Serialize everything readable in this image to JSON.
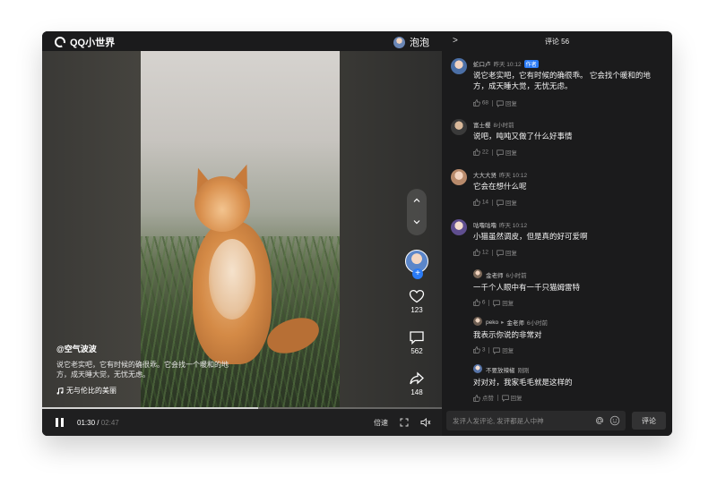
{
  "header": {
    "app_name": "QQ小世界",
    "user_name": "泡泡"
  },
  "video": {
    "author": "@空气波波",
    "description": "说它老实吧，它有时候的确很乖。它会找一个暖和的地方，成天睡大觉，无忧无虑。",
    "music": "无与伦比的美丽",
    "likes": "123",
    "comments": "562",
    "shares": "148",
    "current_time": "01:30",
    "separator": "/",
    "duration": "02:47",
    "progress_fraction": 0.54,
    "speed_label": "倍速"
  },
  "comments_panel": {
    "title": "评论 56",
    "input_placeholder": "发评人发评论, 发评都是人中神",
    "submit_label": "评论",
    "items": [
      {
        "name": "蛇口卢",
        "time": "昨天 10:12",
        "tag": "作者",
        "text": "说它老实吧，它有时候的确很乖。 它会找个暖和的地方，成天睡大觉，无忧无虑。",
        "likes": "68",
        "reply_label": "回复"
      },
      {
        "name": "富士樱",
        "time": "8小时前",
        "text": "说吧，吨吨又做了什么好事情",
        "likes": "22",
        "reply_label": "回复"
      },
      {
        "name": "大大大贤",
        "time": "昨天 10:12",
        "text": "它会在想什么呢",
        "likes": "14",
        "reply_label": "回复"
      },
      {
        "name": "咕噜咕噜",
        "time": "昨天 10:12",
        "text": "小猫虽然调皮，但是真的好可爱啊",
        "likes": "12",
        "reply_label": "回复"
      }
    ],
    "replies": [
      {
        "name": "金老师",
        "time": "6小时前",
        "text": "一千个人眼中有一千只猫姆雷特",
        "likes": "6",
        "reply_label": "回复"
      },
      {
        "name": "peko",
        "arrow": "▸",
        "reply_to": "金老师",
        "time": "6小时前",
        "text": "我表示你说的非常对",
        "likes": "3",
        "reply_label": "回复"
      },
      {
        "name": "不要放辣椒",
        "time": "刚刚",
        "text": "对对对，我家毛毛就是这样的",
        "likes": "点赞",
        "reply_label": "回复"
      }
    ]
  },
  "colors": {
    "accent": "#2a7bf6",
    "panel_bg": "#1b1b1c"
  }
}
